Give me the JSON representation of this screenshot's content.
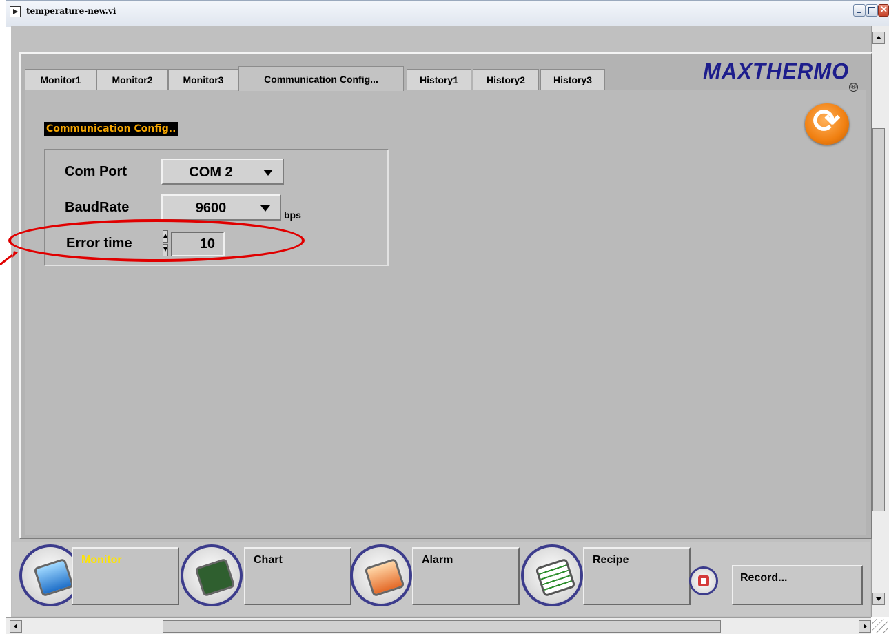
{
  "window": {
    "title": "temperature-new.vi"
  },
  "tabs": [
    {
      "label": "Monitor1"
    },
    {
      "label": "Monitor2"
    },
    {
      "label": "Monitor3"
    },
    {
      "label": "Communication Config..."
    },
    {
      "label": "History1"
    },
    {
      "label": "History2"
    },
    {
      "label": "History3"
    }
  ],
  "active_tab": "Communication Config...",
  "logo": {
    "text": "MAXTHERMO",
    "registered": "®"
  },
  "config": {
    "section_title": "Communication Config..",
    "com_port": {
      "label": "Com Port",
      "value": "COM 2"
    },
    "baudrate": {
      "label": "BaudRate",
      "value": "9600",
      "unit": "bps"
    },
    "error_time": {
      "label": "Error time",
      "value": "10"
    }
  },
  "nav": {
    "monitor": "Monitor",
    "chart": "Chart",
    "alarm": "Alarm",
    "recipe": "Recipe",
    "record": "Record..."
  },
  "colors": {
    "section_title_text": "#f7a700",
    "highlight": "#e00000",
    "logo": "#1d1d8c",
    "monitor_label": "#ffe400"
  },
  "icons": {
    "refresh": "refresh-icon",
    "monitor": "monitor-icon",
    "chart": "chart-icon",
    "alarm": "alarm-icon",
    "recipe": "recipe-icon",
    "save": "floppy-icon"
  }
}
